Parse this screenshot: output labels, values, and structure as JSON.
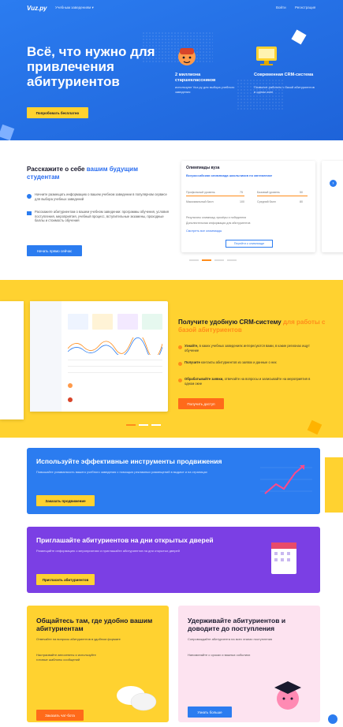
{
  "topbar": {
    "logo": "Vuz.ру",
    "menu": "Учебным заведениям ▾",
    "link_login": "Войти",
    "link_signup": "Регистрация"
  },
  "hero": {
    "title": "Всё, что нужно для привлечения абитуриентов",
    "cta": "Попробовать бесплатно",
    "features": [
      {
        "title": "2 миллиона старшеклассников",
        "desc": "используют Vuz.ру для выбора учебного заведения"
      },
      {
        "title": "Современная CRM-система",
        "desc": "Позволит работать с базой абитуриентов в одном окне"
      }
    ]
  },
  "about": {
    "title_plain": "Расскажите о себе ",
    "title_accent": "вашим будущим студентам",
    "bullets": [
      "Начните размещать информацию о вашем учебном заведении в популярном сервисе для выбора учебных заведений",
      "Расскажите абитуриентам о вашем учебном заведении: программы обучения, условия поступления, мероприятия, учебный процесс, вступительные экзамены, проходные баллы и стоимость обучения"
    ],
    "cta": "Начать прямо сейчас",
    "card": {
      "title": "Олимпиады вуза",
      "subtitle": "Всероссийская олимпиада школьников по математике",
      "rows": [
        [
          "Профильный уровень",
          "75",
          "Базовый уровень",
          "50"
        ],
        [
          "Максимальный балл",
          "100",
          "Средний балл",
          "80"
        ]
      ],
      "lines": [
        "Результаты олимпиад: призёры и победители",
        "Дополнительная информация для абитуриентов"
      ],
      "link": "Смотреть все олимпиады",
      "button": "Перейти к олимпиаде"
    }
  },
  "crm": {
    "title_plain": "Получите удобную CRM-систему ",
    "title_accent": "для работы с базой абитуриентов",
    "bullets": [
      {
        "bold": "Узнайте,",
        "text": "в каких учебных заведениях интересуются вами, в какие регионах ищут обучение"
      },
      {
        "bold": "Получите",
        "text": "контакты абитуриентов из заявок и данные о них"
      },
      {
        "bold": "Обрабатывайте заявки,",
        "text": "отвечайте на вопросы и записывайте на мероприятия в одном окне"
      }
    ],
    "cta": "Получить доступ"
  },
  "promo": {
    "title": "Используйте эффективные инструменты продвижения",
    "text": "Повышайте узнаваемость вашего учебного заведения с помощью рекламных размещений в выдаче и на страницах",
    "cta": "Заказать продвижение"
  },
  "open_days": {
    "title": "Приглашайте абитуриентов на дни открытых дверей",
    "text": "Размещайте информацию о мероприятиях и приглашайте абитуриентов на дни открытых дверей",
    "cta": "Пригласить абитуриентов"
  },
  "chat": {
    "title": "Общайтесь там, где удобно вашим абитуриентам",
    "text1": "Отвечайте на вопросы абитуриентов в удобном формате",
    "text2": "Настраивайте автоответы и используйте готовые шаблоны сообщений",
    "cta": "Заказать чат-бота"
  },
  "retain": {
    "title": "Удерживайте абитуриентов и доводите до поступления",
    "text1": "Сопровождайте абитуриента на всех этапах поступления",
    "text2": "Напоминайте о сроках и важных событиях",
    "cta": "Узнать больше"
  },
  "colors": {
    "hero_blue": "#2b7cf0",
    "yellow": "#ffd230",
    "orange": "#ff6a1a",
    "purple": "#7b3fe4",
    "pink": "#fde3f0"
  }
}
